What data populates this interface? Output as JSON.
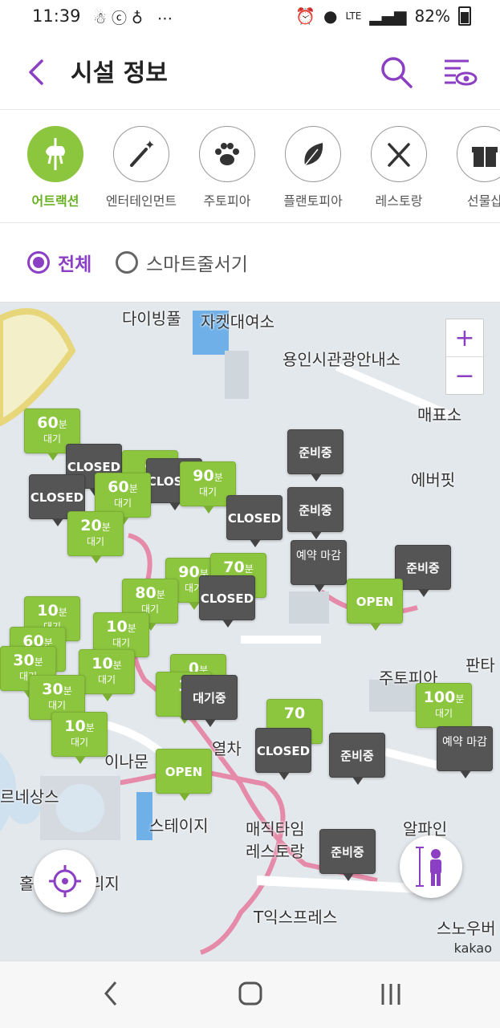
{
  "status_bar": {
    "time": "11:39",
    "battery": "82%",
    "network": "LTE"
  },
  "header": {
    "title": "시설 정보"
  },
  "categories": [
    {
      "label": "어트랙션",
      "active": true
    },
    {
      "label": "엔터테인먼트",
      "active": false
    },
    {
      "label": "주토피아",
      "active": false
    },
    {
      "label": "플랜토피아",
      "active": false
    },
    {
      "label": "레스토랑",
      "active": false
    },
    {
      "label": "선물샵",
      "active": false
    }
  ],
  "filter": {
    "all": "전체",
    "smart": "스마트줄서기",
    "selected": "all"
  },
  "map": {
    "labels": [
      "다이빙풀",
      "자켓대여소",
      "용인시관광안내소",
      "매표소",
      "에버핏",
      "주토피아",
      "판타",
      "알파인",
      "스노우버",
      "T익스프레스",
      "매직타임",
      "레스토랑",
      "스테이지",
      "르네상스",
      "이나문",
      "열차",
      "홀랜",
      "리지"
    ],
    "zoom_in": "+",
    "zoom_out": "−",
    "attribution": "kakao",
    "pins": [
      {
        "kind": "wait",
        "num": "60",
        "unit": "분",
        "sub": "대기"
      },
      {
        "kind": "closed",
        "text": "CLOSED"
      },
      {
        "kind": "wait",
        "num": "60",
        "unit": "분",
        "sub": "대기"
      },
      {
        "kind": "wait",
        "num": "90",
        "unit": "분",
        "sub": "대기"
      },
      {
        "kind": "prep",
        "text": "준비중"
      },
      {
        "kind": "closed",
        "text": "CLOSED"
      },
      {
        "kind": "wait",
        "num": "20",
        "unit": "분",
        "sub": "대기"
      },
      {
        "kind": "prep",
        "text": "준비중"
      },
      {
        "kind": "resv",
        "text": "예약 마감"
      },
      {
        "kind": "prep",
        "text": "준비중"
      },
      {
        "kind": "wait",
        "num": "90",
        "unit": "분",
        "sub": "대기"
      },
      {
        "kind": "wait",
        "num": "70",
        "unit": "분",
        "sub": "대기"
      },
      {
        "kind": "closed",
        "text": "CLOSED"
      },
      {
        "kind": "open",
        "text": "OPEN"
      },
      {
        "kind": "wait",
        "num": "80",
        "unit": "분",
        "sub": "대기"
      },
      {
        "kind": "wait",
        "num": "10",
        "unit": "분",
        "sub": "대기"
      },
      {
        "kind": "wait",
        "num": "10",
        "unit": "분",
        "sub": "대기"
      },
      {
        "kind": "wait",
        "num": "60",
        "unit": "분",
        "sub": "대기"
      },
      {
        "kind": "wait",
        "num": "30",
        "unit": "분",
        "sub": "대기"
      },
      {
        "kind": "wait",
        "num": "10",
        "unit": "분",
        "sub": "대기"
      },
      {
        "kind": "wait",
        "num": "30",
        "unit": "분",
        "sub": "대기"
      },
      {
        "kind": "waiting",
        "text": "대기중"
      },
      {
        "kind": "wait",
        "num": "100",
        "unit": "분",
        "sub": "대기"
      },
      {
        "kind": "resv",
        "text": "예약 마감"
      },
      {
        "kind": "wait",
        "num": "10",
        "unit": "분",
        "sub": "대기"
      },
      {
        "kind": "closed",
        "text": "CLOSED"
      },
      {
        "kind": "prep",
        "text": "준비중"
      },
      {
        "kind": "open",
        "text": "OPEN"
      },
      {
        "kind": "prep",
        "text": "준비중"
      },
      {
        "kind": "wait",
        "num": "70",
        "unit": "분",
        "sub": ""
      },
      {
        "kind": "wait",
        "num": "0",
        "unit": "분",
        "sub": ""
      },
      {
        "kind": "wait",
        "num": "3",
        "unit": "",
        "sub": ""
      },
      {
        "kind": "wait",
        "num": "4",
        "unit": "",
        "sub": ""
      }
    ]
  },
  "colors": {
    "accent": "#8b3fc3",
    "green": "#8cc63f",
    "gray_pin": "#555555"
  }
}
